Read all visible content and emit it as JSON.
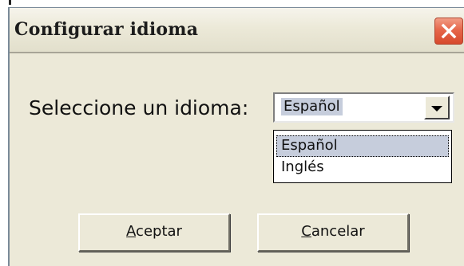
{
  "window": {
    "title": "Configurar idioma",
    "close_icon": "close-x-icon",
    "close_color": "#e2583c"
  },
  "prompt": {
    "label": "Seleccione un idioma:"
  },
  "language_select": {
    "value": "Español",
    "expanded": true,
    "arrow_icon": "chevron-down-icon",
    "options": [
      {
        "label": "Español",
        "selected": true
      },
      {
        "label": "Inglés",
        "selected": false
      }
    ],
    "highlight_color": "#c6cddc"
  },
  "buttons": {
    "accept": {
      "mnemonic": "A",
      "rest": "ceptar"
    },
    "cancel": {
      "mnemonic": "C",
      "rest": "ancelar"
    }
  }
}
